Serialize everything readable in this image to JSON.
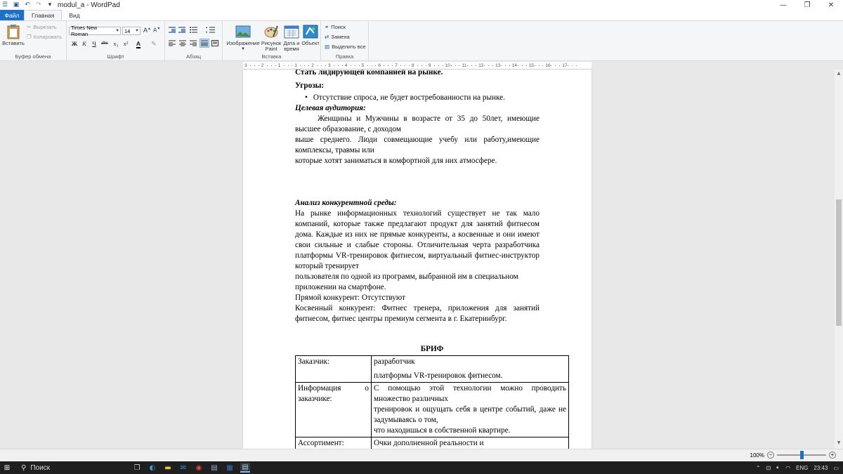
{
  "window": {
    "title": "modul_a - WordPad",
    "minimize": "—",
    "maximize": "❐",
    "close": "✕"
  },
  "tabs": {
    "file": "Файл",
    "home": "Главная",
    "view": "Вид"
  },
  "ribbon": {
    "clipboard": {
      "label": "Буфер обмена",
      "paste": "Вставить",
      "cut": "Вырезать",
      "copy": "Копировать"
    },
    "font": {
      "label": "Шрифт",
      "family": "Times New Roman",
      "size": "14",
      "bold": "Ж",
      "italic": "К",
      "underline": "Ч",
      "strike": "abc",
      "subscript": "x₂",
      "superscript": "x²"
    },
    "paragraph": {
      "label": "Абзац"
    },
    "insert": {
      "label": "Вставка",
      "image": "Изображение",
      "paint_line1": "Рисунок",
      "paint_line2": "Paint",
      "datetime_line1": "Дата и",
      "datetime_line2": "время",
      "object": "Объект"
    },
    "edit": {
      "label": "Правка",
      "find": "Поиск",
      "replace": "Замена",
      "select_all": "Выделить все"
    }
  },
  "ruler": {
    "ticks": [
      "3",
      "2",
      "1",
      "1",
      "2",
      "3",
      "4",
      "5",
      "6",
      "7",
      "8",
      "9",
      "10",
      "11",
      "12",
      "13",
      "14",
      "15",
      "16",
      "17"
    ]
  },
  "document": {
    "clipped_line": "Стать лидирующей компанией на рынке.",
    "threats_heading": "Угрозы:",
    "threat_bullet": "Отсутствие спроса, не будет востребованности на рынке.",
    "audience_heading": "Целевая аудитория:",
    "audience_p1": "Женщины и Мужчины в возрасте от 35 до 50лет, имеющие высшее образование, с доходом",
    "audience_p2": "выше среднего. Люди совмещающие учебу или работу,имеющие комплексы, травмы или",
    "audience_p3": "которые хотят заниматься в комфортной для них атмосфере.",
    "competition_heading": "Анализ конкурентной среды:",
    "competition_p1": "На рынке информационных технологий существует не так мало компаний, которые также предлагают продукт для занятий фитнесом дома. Каждые из них не прямые конкуренты, а косвенные и они имеют свои сильные и слабые стороны. Отличительная черта разработчика платформы VR-тренировок фитнесом, виртуальный фитнес-инструктор который тренирует",
    "competition_p2": "пользователя по одной из программ, выбранной им в специальном приложении на смартфоне.",
    "direct_competitor": "Прямой конкурент: Отсутствуют",
    "indirect_competitor": "Косвенный конкурент: Фитнес тренера, приложения для занятий фитнесом, фитнес центры премиум сегмента в г. Екатеринбург.",
    "brief_title": "БРИФ",
    "brief_rows": [
      {
        "key": "Заказчик:",
        "line1": "разработчик",
        "line2": "платформы VR-тренировок фитнесом."
      },
      {
        "key": "Информация о заказчике:",
        "line1": "С помощью этой технологии можно проводить множество различных",
        "line2": "тренировок и ощущать себя в центре событий, даже не задумываясь о том,",
        "line3": "что находишься в собственной квартире."
      },
      {
        "key": "Ассортимент:",
        "line1": "Очки дополненной реальности и"
      }
    ]
  },
  "status": {
    "zoom": "100%",
    "minus": "−",
    "plus": "+"
  },
  "taskbar": {
    "search": "Поиск",
    "lang": "ENG",
    "time": "23:43"
  }
}
